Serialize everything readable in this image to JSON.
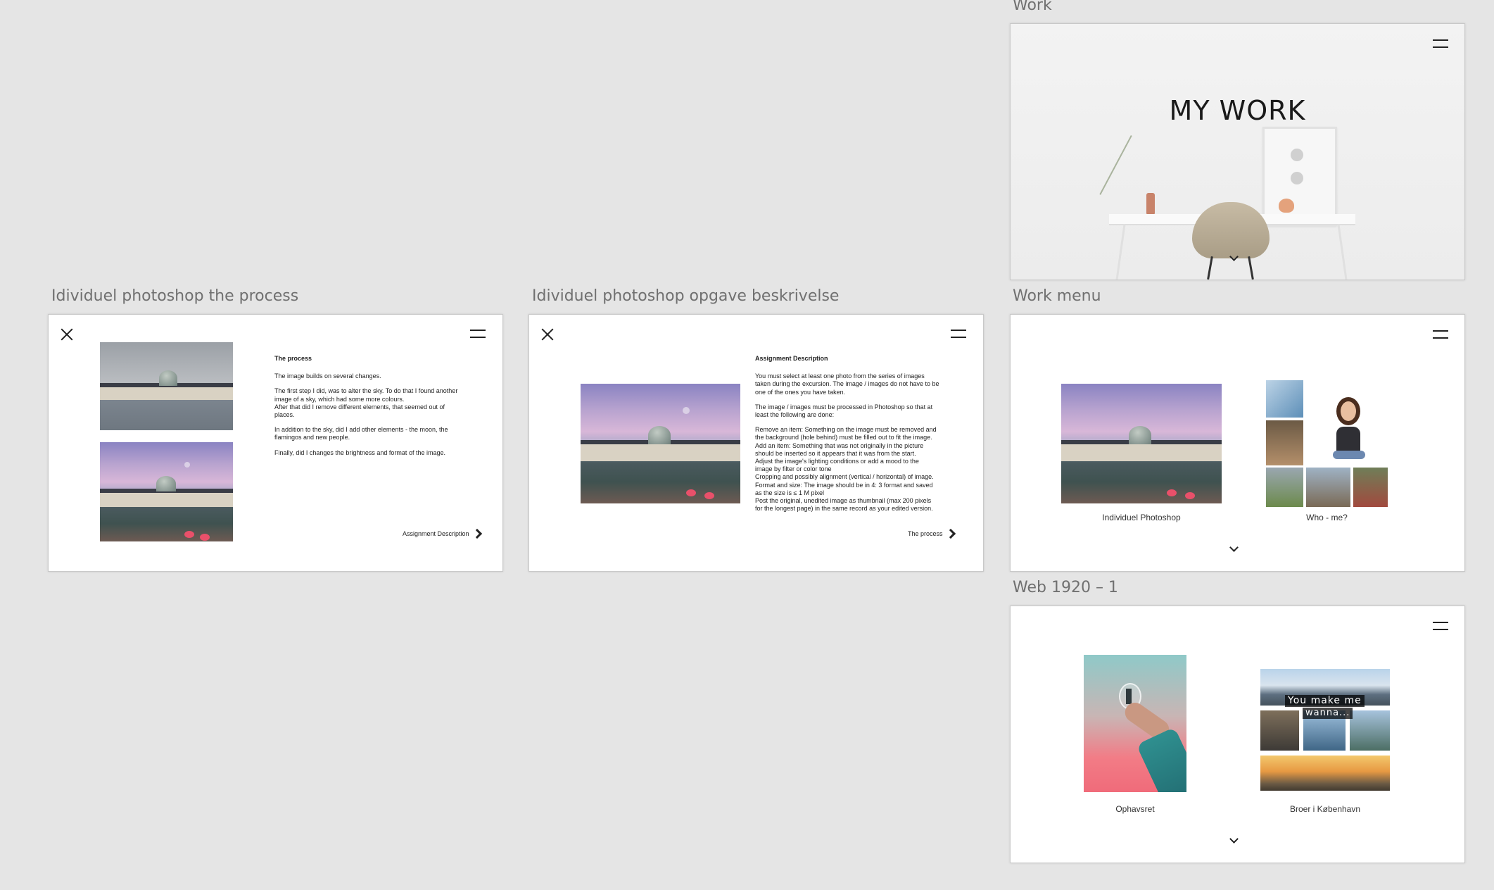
{
  "artboards": {
    "work": {
      "label": "Work",
      "hero_title": "MY WORK"
    },
    "process": {
      "label": "Idividuel photoshop the process",
      "heading": "The process",
      "paragraphs": [
        "The image builds on several changes.",
        "The first step I did, was to alter the sky. To do that I found another\nimage of a sky, which had some more colours.\nAfter that did I remove different elements, that seemed out of\nplaces.",
        "In addition to the sky, did I add other elements - the moon, the\nflamingos and new people.",
        "Finally, did I changes the brightness and format of the image."
      ],
      "link_label": "Assignment Description"
    },
    "assignment": {
      "label": "Idividuel photoshop opgave beskrivelse",
      "heading": "Assignment Description",
      "paragraphs": [
        "You must select at least one photo from the series of images\ntaken during the excursion. The image / images do not have to be\none of the ones you have taken.",
        "The image / images must be processed in Photoshop so that at\nleast the following are done:",
        "Remove an item: Something on the image must be removed and\nthe background (hole behind) must be filled out to fit the image.\nAdd an item: Something that was not originally in the picture\nshould be inserted so it appears that it was from the start.\nAdjust the image's lighting conditions or add a mood to the\nimage by filter or color tone\nCropping and possibly alignment (vertical / horizontal) of image.\nFormat and size: The image should be in 4: 3 format and saved\nas the size is ≤ 1 M pixel\nPost the original, unedited image as thumbnail (max 200 pixels\nfor the longest page) in the same record as your edited version."
      ],
      "link_label": "The process"
    },
    "work_menu": {
      "label": "Work menu",
      "items": [
        {
          "caption": "Individuel Photoshop"
        },
        {
          "caption": "Who - me?"
        }
      ]
    },
    "web": {
      "label": "Web 1920 – 1",
      "items": [
        {
          "caption": "Ophavsret"
        },
        {
          "caption": "Broer i København"
        }
      ],
      "collage_text_1": "You make me",
      "collage_text_2": "wanna..."
    }
  }
}
